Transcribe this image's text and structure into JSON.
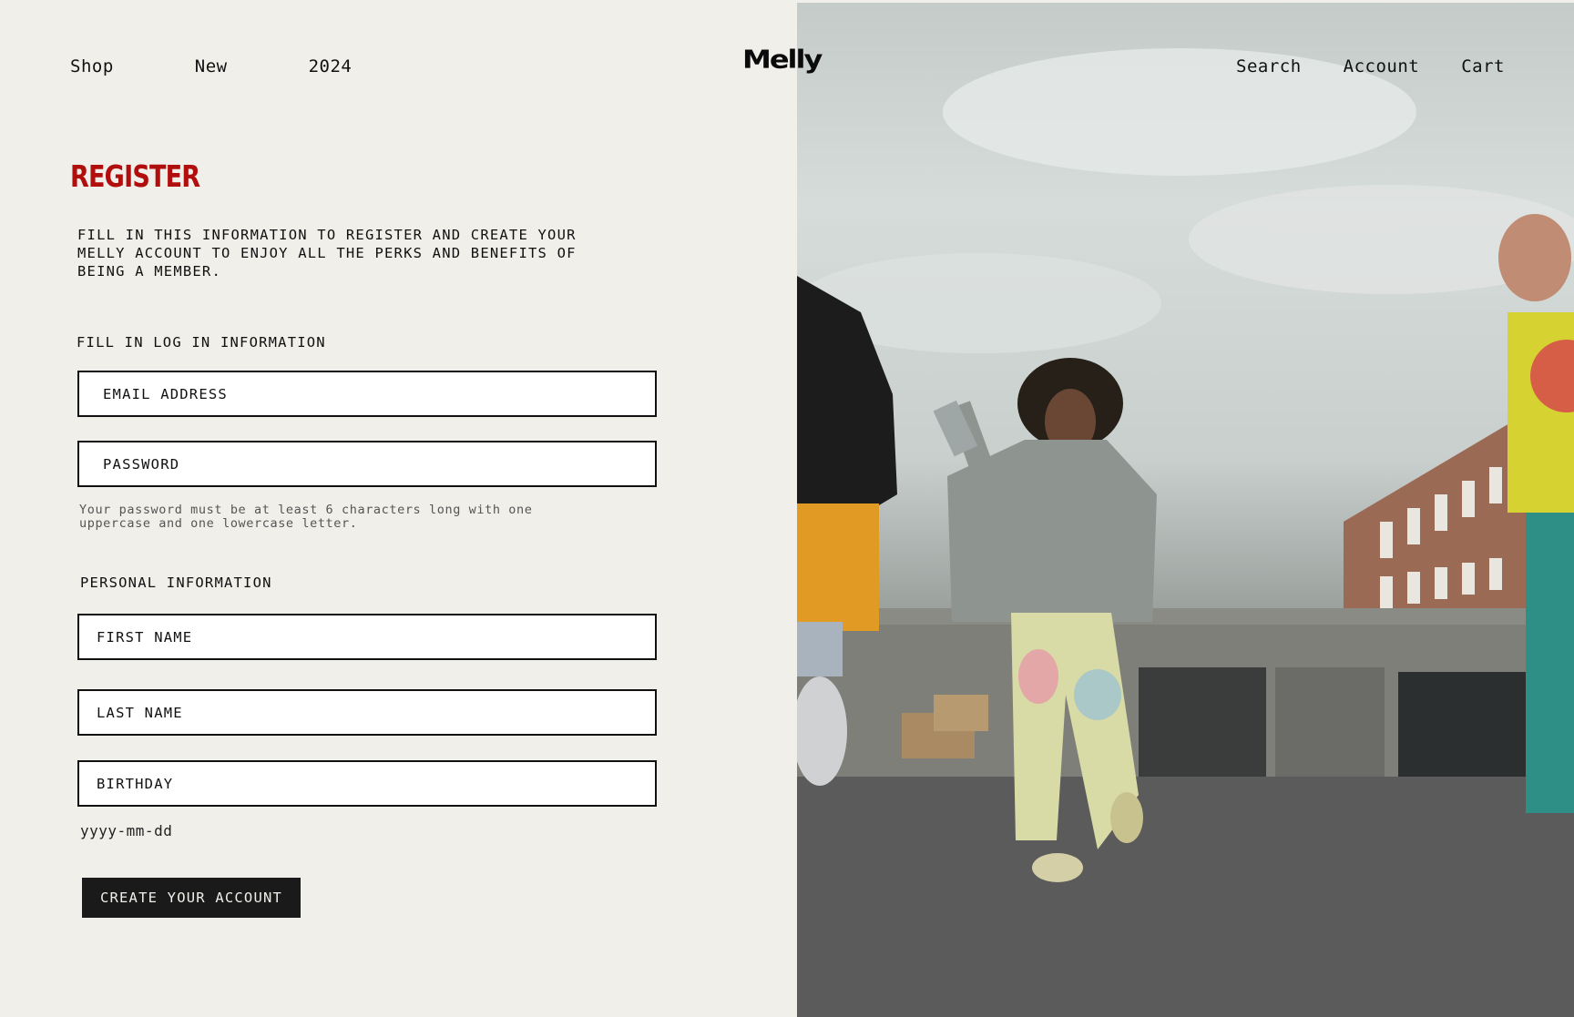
{
  "nav": {
    "left": [
      "Shop",
      "New",
      "2024"
    ],
    "logo": "Melly",
    "right": [
      "Search",
      "Account",
      "Cart"
    ]
  },
  "register": {
    "title": "REGISTER",
    "intro": "FILL IN THIS INFORMATION TO REGISTER AND CREATE YOUR MELLY ACCOUNT TO ENJOY ALL THE PERKS AND BENEFITS OF BEING A MEMBER.",
    "login_section": "FILL IN LOG IN INFORMATION",
    "email_placeholder": "EMAIL ADDRESS",
    "password_placeholder": "PASSWORD",
    "password_hint": "Your password must be at least 6 characters long with one uppercase and one lowercase letter.",
    "personal_section": "PERSONAL INFORMATION",
    "first_name_placeholder": "FIRST NAME",
    "last_name_placeholder": "LAST NAME",
    "birthday_placeholder": "BIRTHDAY",
    "birthday_hint": "yyyy-mm-dd",
    "submit_label": "CREATE YOUR ACCOUNT"
  },
  "colors": {
    "background": "#f0efea",
    "accent_title": "#b10e0e",
    "button": "#1a1a1a"
  }
}
